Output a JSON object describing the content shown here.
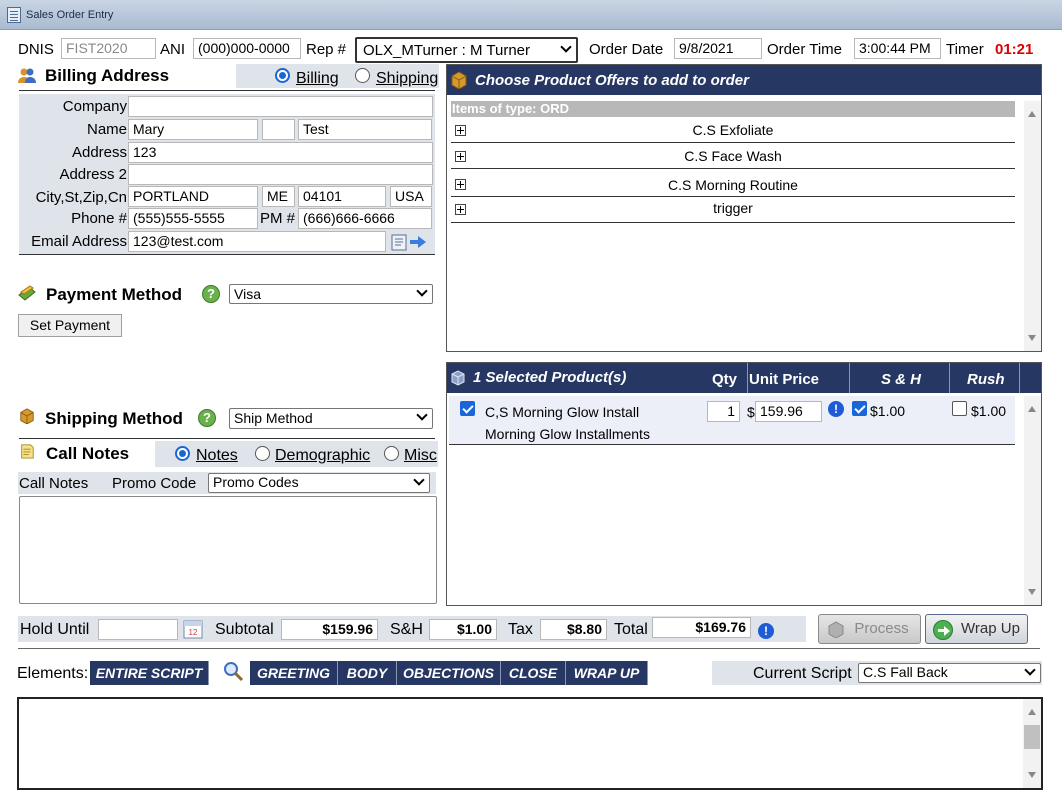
{
  "window": {
    "title": "Sales Order Entry"
  },
  "header": {
    "dnis_label": "DNIS",
    "dnis_value": "FIST2020",
    "ani_label": "ANI",
    "ani_value": "(000)000-0000",
    "rep_label": "Rep #",
    "rep_value": "OLX_MTurner : M Turner",
    "order_date_label": "Order Date",
    "order_date_value": "9/8/2021",
    "order_time_label": "Order Time",
    "order_time_value": "3:00:44 PM",
    "timer_label": "Timer",
    "timer_value": "01:21",
    "timer_color": "#dd0000"
  },
  "billing": {
    "title": "Billing Address",
    "radio_billing": "Billing",
    "radio_shipping": "Shipping",
    "company_label": "Company",
    "company_value": "",
    "name_label": "Name",
    "first_name": "Mary",
    "middle_initial": "",
    "last_name": "Test",
    "address_label": "Address",
    "address_value": "123",
    "address2_label": "Address 2",
    "address2_value": "",
    "city_label": "City,St,Zip,Cn",
    "city_value": "PORTLAND",
    "state_value": "ME",
    "zip_value": "04101",
    "country_value": "USA",
    "phone_label": "Phone #",
    "phone_value": "(555)555-5555",
    "pm_label": "PM #",
    "pm_value": "(666)666-6666",
    "email_label": "Email Address",
    "email_value": "123@test.com"
  },
  "payment": {
    "title": "Payment Method",
    "method_value": "Visa",
    "set_payment_label": "Set Payment"
  },
  "shipping": {
    "title": "Shipping Method",
    "method_value": "Ship Method"
  },
  "call_notes": {
    "title": "Call Notes",
    "radio_notes": "Notes",
    "radio_demographic": "Demographic",
    "radio_misc": "Misc",
    "notes_label": "Call Notes",
    "promo_label": "Promo Code",
    "promo_value": "Promo Codes",
    "notes_text": ""
  },
  "offers": {
    "title": "Choose Product Offers to add to order",
    "group_label": "Items of type: ORD",
    "items": [
      "C.S Exfoliate",
      "C.S Face Wash",
      "C.S Morning Routine",
      "trigger"
    ]
  },
  "selected": {
    "title": "1 Selected Product(s)",
    "col_qty": "Qty",
    "col_price": "Unit Price",
    "col_sh": "S & H",
    "col_rush": "Rush",
    "rows": [
      {
        "name_line1": "C,S Morning Glow Install",
        "name_line2": "Morning Glow Installments",
        "qty": "1",
        "currency": "$",
        "price": "159.96",
        "sh_value": "$1.00",
        "rush_value": "$1.00"
      }
    ]
  },
  "totals": {
    "hold_label": "Hold Until",
    "hold_value": "",
    "subtotal_label": "Subtotal",
    "subtotal_value": "$159.96",
    "sh_label": "S&H",
    "sh_value": "$1.00",
    "tax_label": "Tax",
    "tax_value": "$8.80",
    "total_label": "Total",
    "total_value": "$169.76",
    "process_label": "Process",
    "wrapup_label": "Wrap Up"
  },
  "script": {
    "elements_label": "Elements:",
    "tabs": [
      "ENTIRE SCRIPT",
      "GREETING",
      "BODY",
      "OBJECTIONS",
      "CLOSE",
      "WRAP UP"
    ],
    "current_label": "Current Script",
    "current_value": "C.S Fall Back",
    "text": ""
  },
  "colors": {
    "navy_header": "#273763",
    "panel_gray": "#dfe3ea",
    "accent_blue": "#1a66d6"
  }
}
